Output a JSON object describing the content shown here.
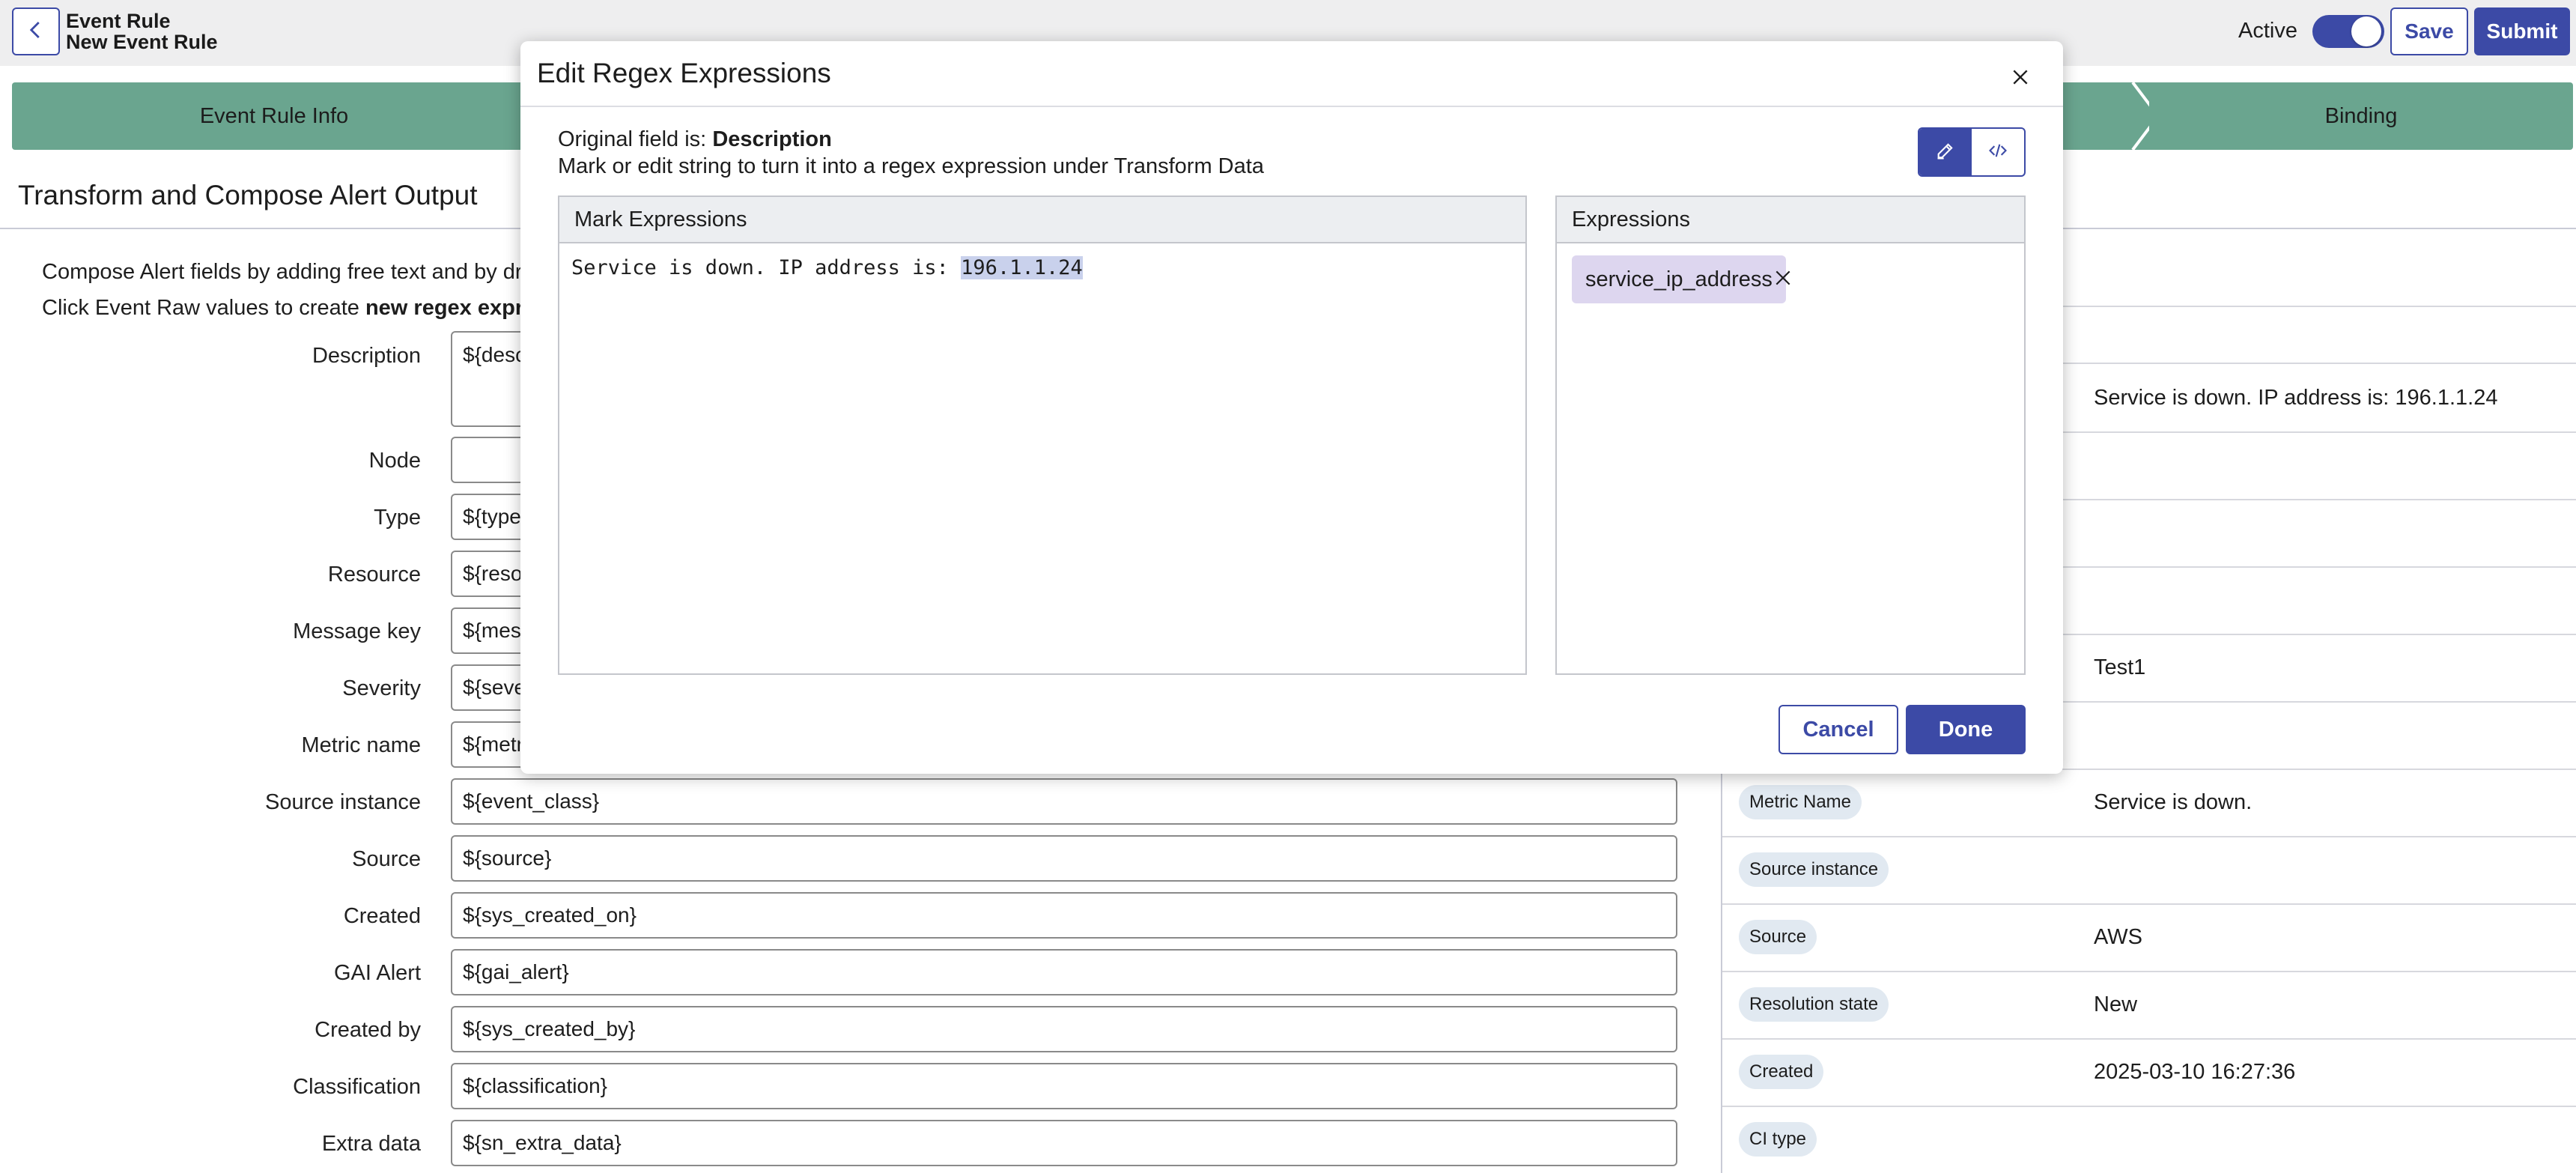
{
  "header": {
    "title_line1": "Event Rule",
    "title_line2": "New Event Rule",
    "active_label": "Active",
    "active_on": true,
    "save_label": "Save",
    "submit_label": "Submit"
  },
  "stepper": {
    "steps": [
      "Event Rule Info",
      "",
      "Binding"
    ]
  },
  "section": {
    "title": "Transform and Compose Alert Output",
    "desc1": "Compose Alert fields by adding free text and by dragg",
    "desc2_prefix": "Click Event Raw values to create ",
    "desc2_bold": "new regex expressi"
  },
  "form": {
    "fields": [
      {
        "label": "Description",
        "value": "${desc"
      },
      {
        "label": "Node",
        "value": ""
      },
      {
        "label": "Type",
        "value": "${type"
      },
      {
        "label": "Resource",
        "value": "${reso"
      },
      {
        "label": "Message key",
        "value": "${mess"
      },
      {
        "label": "Severity",
        "value": "${seve"
      },
      {
        "label": "Metric name",
        "value": "${metr"
      },
      {
        "label": "Source instance",
        "value": "${event_class}"
      },
      {
        "label": "Source",
        "value": "${source}"
      },
      {
        "label": "Created",
        "value": "${sys_created_on}"
      },
      {
        "label": "GAI Alert",
        "value": "${gai_alert}"
      },
      {
        "label": "Created by",
        "value": "${sys_created_by}"
      },
      {
        "label": "Classification",
        "value": "${classification}"
      },
      {
        "label": "Extra data",
        "value": "${sn_extra_data}"
      }
    ]
  },
  "raw_panel": {
    "rows": [
      {
        "pill": "",
        "value": "Service is down. IP address is: 196.1.1.24"
      },
      {
        "pill": "",
        "value": ""
      },
      {
        "pill": "",
        "value": ""
      },
      {
        "pill": "",
        "value": ""
      },
      {
        "pill": "",
        "value": "Test1"
      },
      {
        "pill": "",
        "value": ""
      },
      {
        "pill": "Metric Name",
        "value": "Service is down."
      },
      {
        "pill": "Source instance",
        "value": ""
      },
      {
        "pill": "Source",
        "value": "AWS"
      },
      {
        "pill": "Resolution state",
        "value": "New"
      },
      {
        "pill": "Created",
        "value": "2025-03-10 16:27:36"
      },
      {
        "pill": "CI type",
        "value": ""
      }
    ]
  },
  "modal": {
    "title": "Edit Regex Expressions",
    "original_prefix": "Original field is: ",
    "original_field": "Description",
    "hint": "Mark or edit string to turn it into a regex expression under Transform Data",
    "mark_header": "Mark Expressions",
    "mark_text_plain": "Service is down. IP address is: ",
    "mark_text_highlight": "196.1.1.24",
    "expr_header": "Expressions",
    "expressions": [
      "service_ip_address"
    ],
    "cancel_label": "Cancel",
    "done_label": "Done"
  },
  "icons": {
    "back": "chevron-left-icon",
    "close": "close-icon",
    "mark_mode": "pencil-icon",
    "code_mode": "code-icon",
    "remove": "close-icon"
  },
  "colors": {
    "accent": "#3c4aa6",
    "step_bg": "#6aa58f",
    "highlight": "#c9d1ec",
    "chip_bg": "#ddd6ef",
    "pill_bg": "#e1e9f1"
  }
}
